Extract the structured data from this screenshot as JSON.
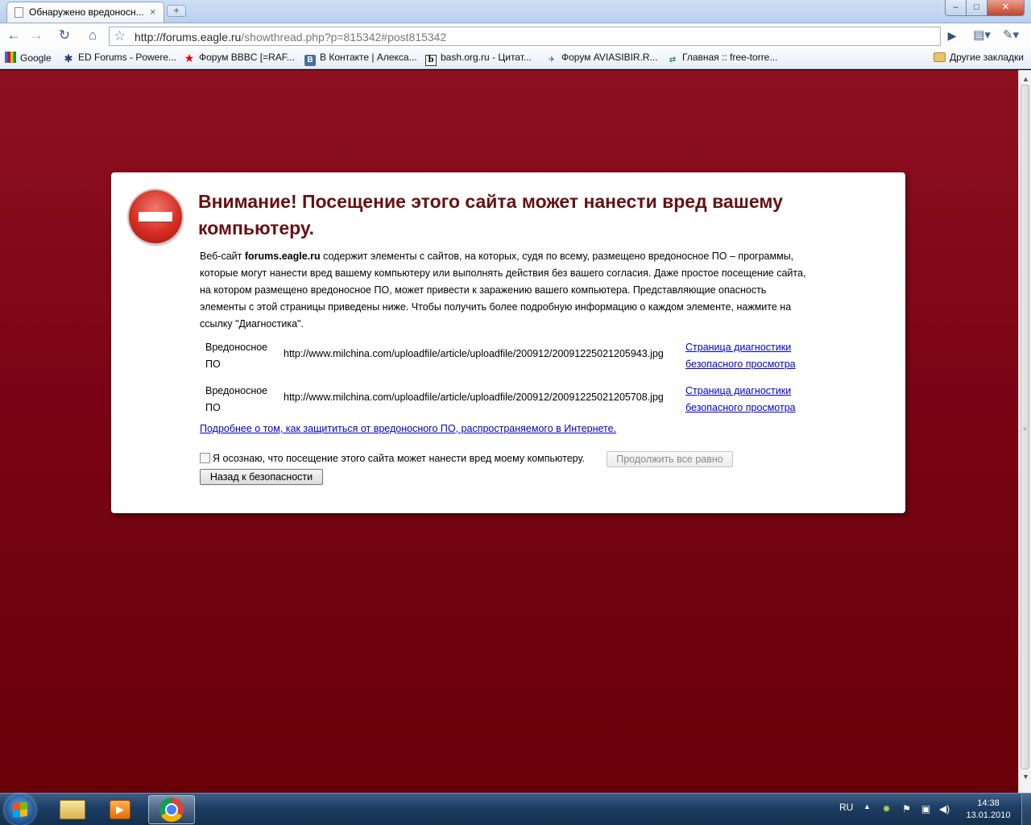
{
  "window": {
    "tab_title": "Обнаружено вредоносн...",
    "tab_close": "×",
    "new_tab": "+",
    "minimize": "–",
    "maximize": "□",
    "close": "✕"
  },
  "toolbar": {
    "back_icon": "←",
    "forward_icon": "→",
    "reload_icon": "↻",
    "home_icon": "⌂",
    "star_icon": "☆",
    "url_host": "http://forums.eagle.ru",
    "url_rest": "/showthread.php?p=815342#post815342",
    "go_icon": "▶",
    "page_menu_icon": "▤▾",
    "wrench_icon": "✎▾"
  },
  "bookmarks": {
    "items": [
      {
        "label": "Google",
        "icon": "google-icon",
        "glyph": ""
      },
      {
        "label": "ED Forums - Powere...",
        "icon": "ed-icon",
        "glyph": "✱"
      },
      {
        "label": "Форум BBBC [=RAF...",
        "icon": "star-icon",
        "glyph": "★"
      },
      {
        "label": "В Контакте | Алекса...",
        "icon": "vk-icon",
        "glyph": "B"
      },
      {
        "label": "bash.org.ru - Цитат...",
        "icon": "bash-icon",
        "glyph": "b"
      },
      {
        "label": "Форум AVIASIBIR.R...",
        "icon": "plane-icon",
        "glyph": "✈"
      },
      {
        "label": "Главная :: free-torre...",
        "icon": "torrent-icon",
        "glyph": "⇄"
      }
    ],
    "other": "Другие закладки"
  },
  "warning": {
    "headline": "Внимание! Посещение этого сайта может нанести вред вашему компьютеру.",
    "body_prefix": "Веб-сайт ",
    "site": "forums.eagle.ru",
    "body_suffix": " содержит элементы с сайтов, на которых, судя по всему, размещено вредоносное ПО – программы, которые могут нанести вред вашему компьютеру или выполнять действия без вашего согласия. Даже простое посещение сайта, на котором размещено вредоносное ПО, может привести к заражению вашего компьютера. Представляющие опасность элементы с этой страницы приведены ниже. Чтобы получить более подробную информацию о каждом элементе, нажмите на ссылку \"Диагностика\".",
    "threats": [
      {
        "type": "Вредоносное ПО",
        "url": "http://www.milchina.com/uploadfile/article/uploadfile/200912/20091225021205943.jpg",
        "link": "Страница диагностики безопасного просмотра"
      },
      {
        "type": "Вредоносное ПО",
        "url": "http://www.milchina.com/uploadfile/article/uploadfile/200912/20091225021205708.jpg",
        "link": "Страница диагностики безопасного просмотра"
      }
    ],
    "learn_more": "Подробнее о том, как защититься от вредоносного ПО, распространяемого в Интернете.",
    "ack_label": "Я осознаю, что посещение этого сайта может нанести вред моему компьютеру.",
    "proceed_button": "Продолжить все равно",
    "back_button": "Назад к безопасности"
  },
  "taskbar": {
    "apps": [
      "explorer-icon",
      "media-player-icon",
      "chrome-icon"
    ],
    "language": "RU",
    "tray_up": "▲",
    "time": "14:38",
    "date": "13.01.2010"
  },
  "colors": {
    "page_background": "#7a0415",
    "headline": "#661111",
    "link": "#0000cc",
    "stop_icon": "#d62d22"
  }
}
